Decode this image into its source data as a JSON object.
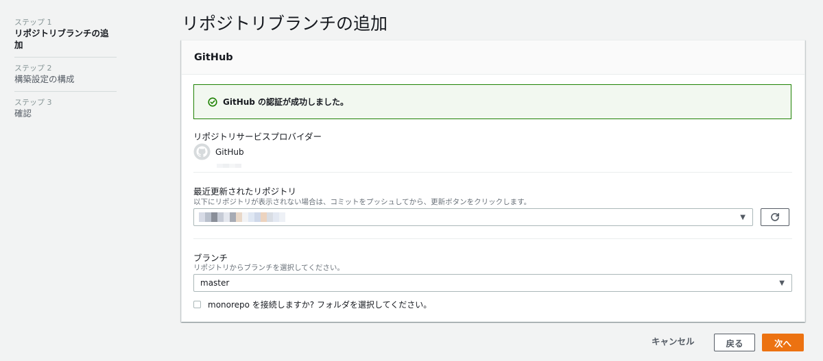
{
  "steps": [
    {
      "number": "ステップ 1",
      "title": "リポジトリブランチの追加",
      "active": true
    },
    {
      "number": "ステップ 2",
      "title": "構築設定の構成",
      "active": false
    },
    {
      "number": "ステップ 3",
      "title": "確認",
      "active": false
    }
  ],
  "page": {
    "title": "リポジトリブランチの追加"
  },
  "panel": {
    "title": "GitHub",
    "alert": {
      "text": "GitHub の認証が成功しました。",
      "icon": "check-circle-icon",
      "color": "#1d8102"
    },
    "provider": {
      "label": "リポジトリサービスプロバイダー",
      "name": "GitHub",
      "icon": "github-icon"
    },
    "repository": {
      "label": "最近更新されたリポジトリ",
      "description": "以下にリポジトリが表示されない場合は、コミットをプッシュしてから、更新ボタンをクリックします。",
      "refresh_icon": "refresh-icon"
    },
    "branch": {
      "label": "ブランチ",
      "description": "リポジトリからブランチを選択してください。",
      "selected": "master"
    },
    "monorepo": {
      "label": "monorepo を接続しますか? フォルダを選択してください。",
      "checked": false
    }
  },
  "footer": {
    "cancel": "キャンセル",
    "back": "戻る",
    "next": "次へ"
  },
  "colors": {
    "accent": "#ec7211",
    "success": "#1d8102",
    "background": "#f2f3f3"
  }
}
